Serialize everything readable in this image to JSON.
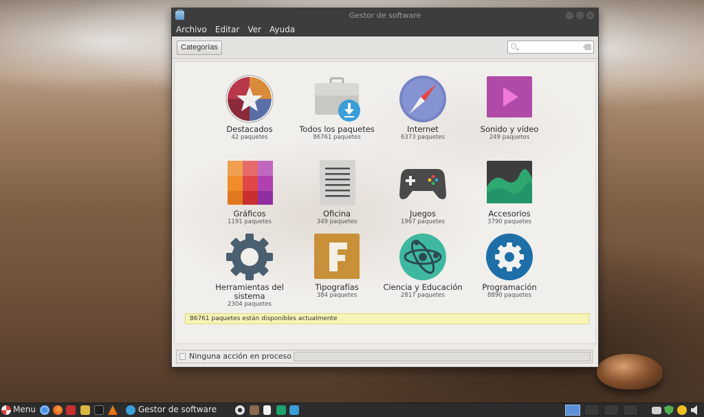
{
  "window": {
    "title": "Gestor de software",
    "menu": [
      "Archivo",
      "Editar",
      "Ver",
      "Ayuda"
    ]
  },
  "toolbar": {
    "categories_label": "Categorías",
    "search_placeholder": ""
  },
  "categories": [
    {
      "name": "Destacados",
      "count": "42 paquetes",
      "icon": "star-icon"
    },
    {
      "name": "Todos los paquetes",
      "count": "86761 paquetes",
      "icon": "download-package-icon"
    },
    {
      "name": "Internet",
      "count": "6373 paquetes",
      "icon": "compass-icon"
    },
    {
      "name": "Sonido y vídeo",
      "count": "249 paquetes",
      "icon": "play-icon"
    },
    {
      "name": "Gráficos",
      "count": "1191 paquetes",
      "icon": "color-palette-icon"
    },
    {
      "name": "Oficina",
      "count": "349 paquetes",
      "icon": "document-icon"
    },
    {
      "name": "Juegos",
      "count": "1967 paquetes",
      "icon": "gamepad-icon"
    },
    {
      "name": "Accesorios",
      "count": "3790 paquetes",
      "icon": "graph-icon"
    },
    {
      "name": "Herramientas del sistema",
      "count": "2304 paquetes",
      "icon": "gear-icon"
    },
    {
      "name": "Tipografías",
      "count": "384 paquetes",
      "icon": "font-icon"
    },
    {
      "name": "Ciencia y Educación",
      "count": "2817 paquetes",
      "icon": "atom-icon"
    },
    {
      "name": "Programación",
      "count": "8890 paquetes",
      "icon": "gear-circle-icon"
    }
  ],
  "status": {
    "available_text": "86761 paquetes están disponibles actualmente",
    "action_text": "Ninguna acción en proceso"
  },
  "taskbar": {
    "menu_label": "Menu",
    "task_label": "Gestor de software"
  },
  "colors": {
    "titlebar": "#3d3d3d",
    "window_bg": "#eceae7",
    "status_highlight": "#f8f4b8",
    "taskbar": "#2c2c2c",
    "active_workspace": "#5b8fd8"
  }
}
